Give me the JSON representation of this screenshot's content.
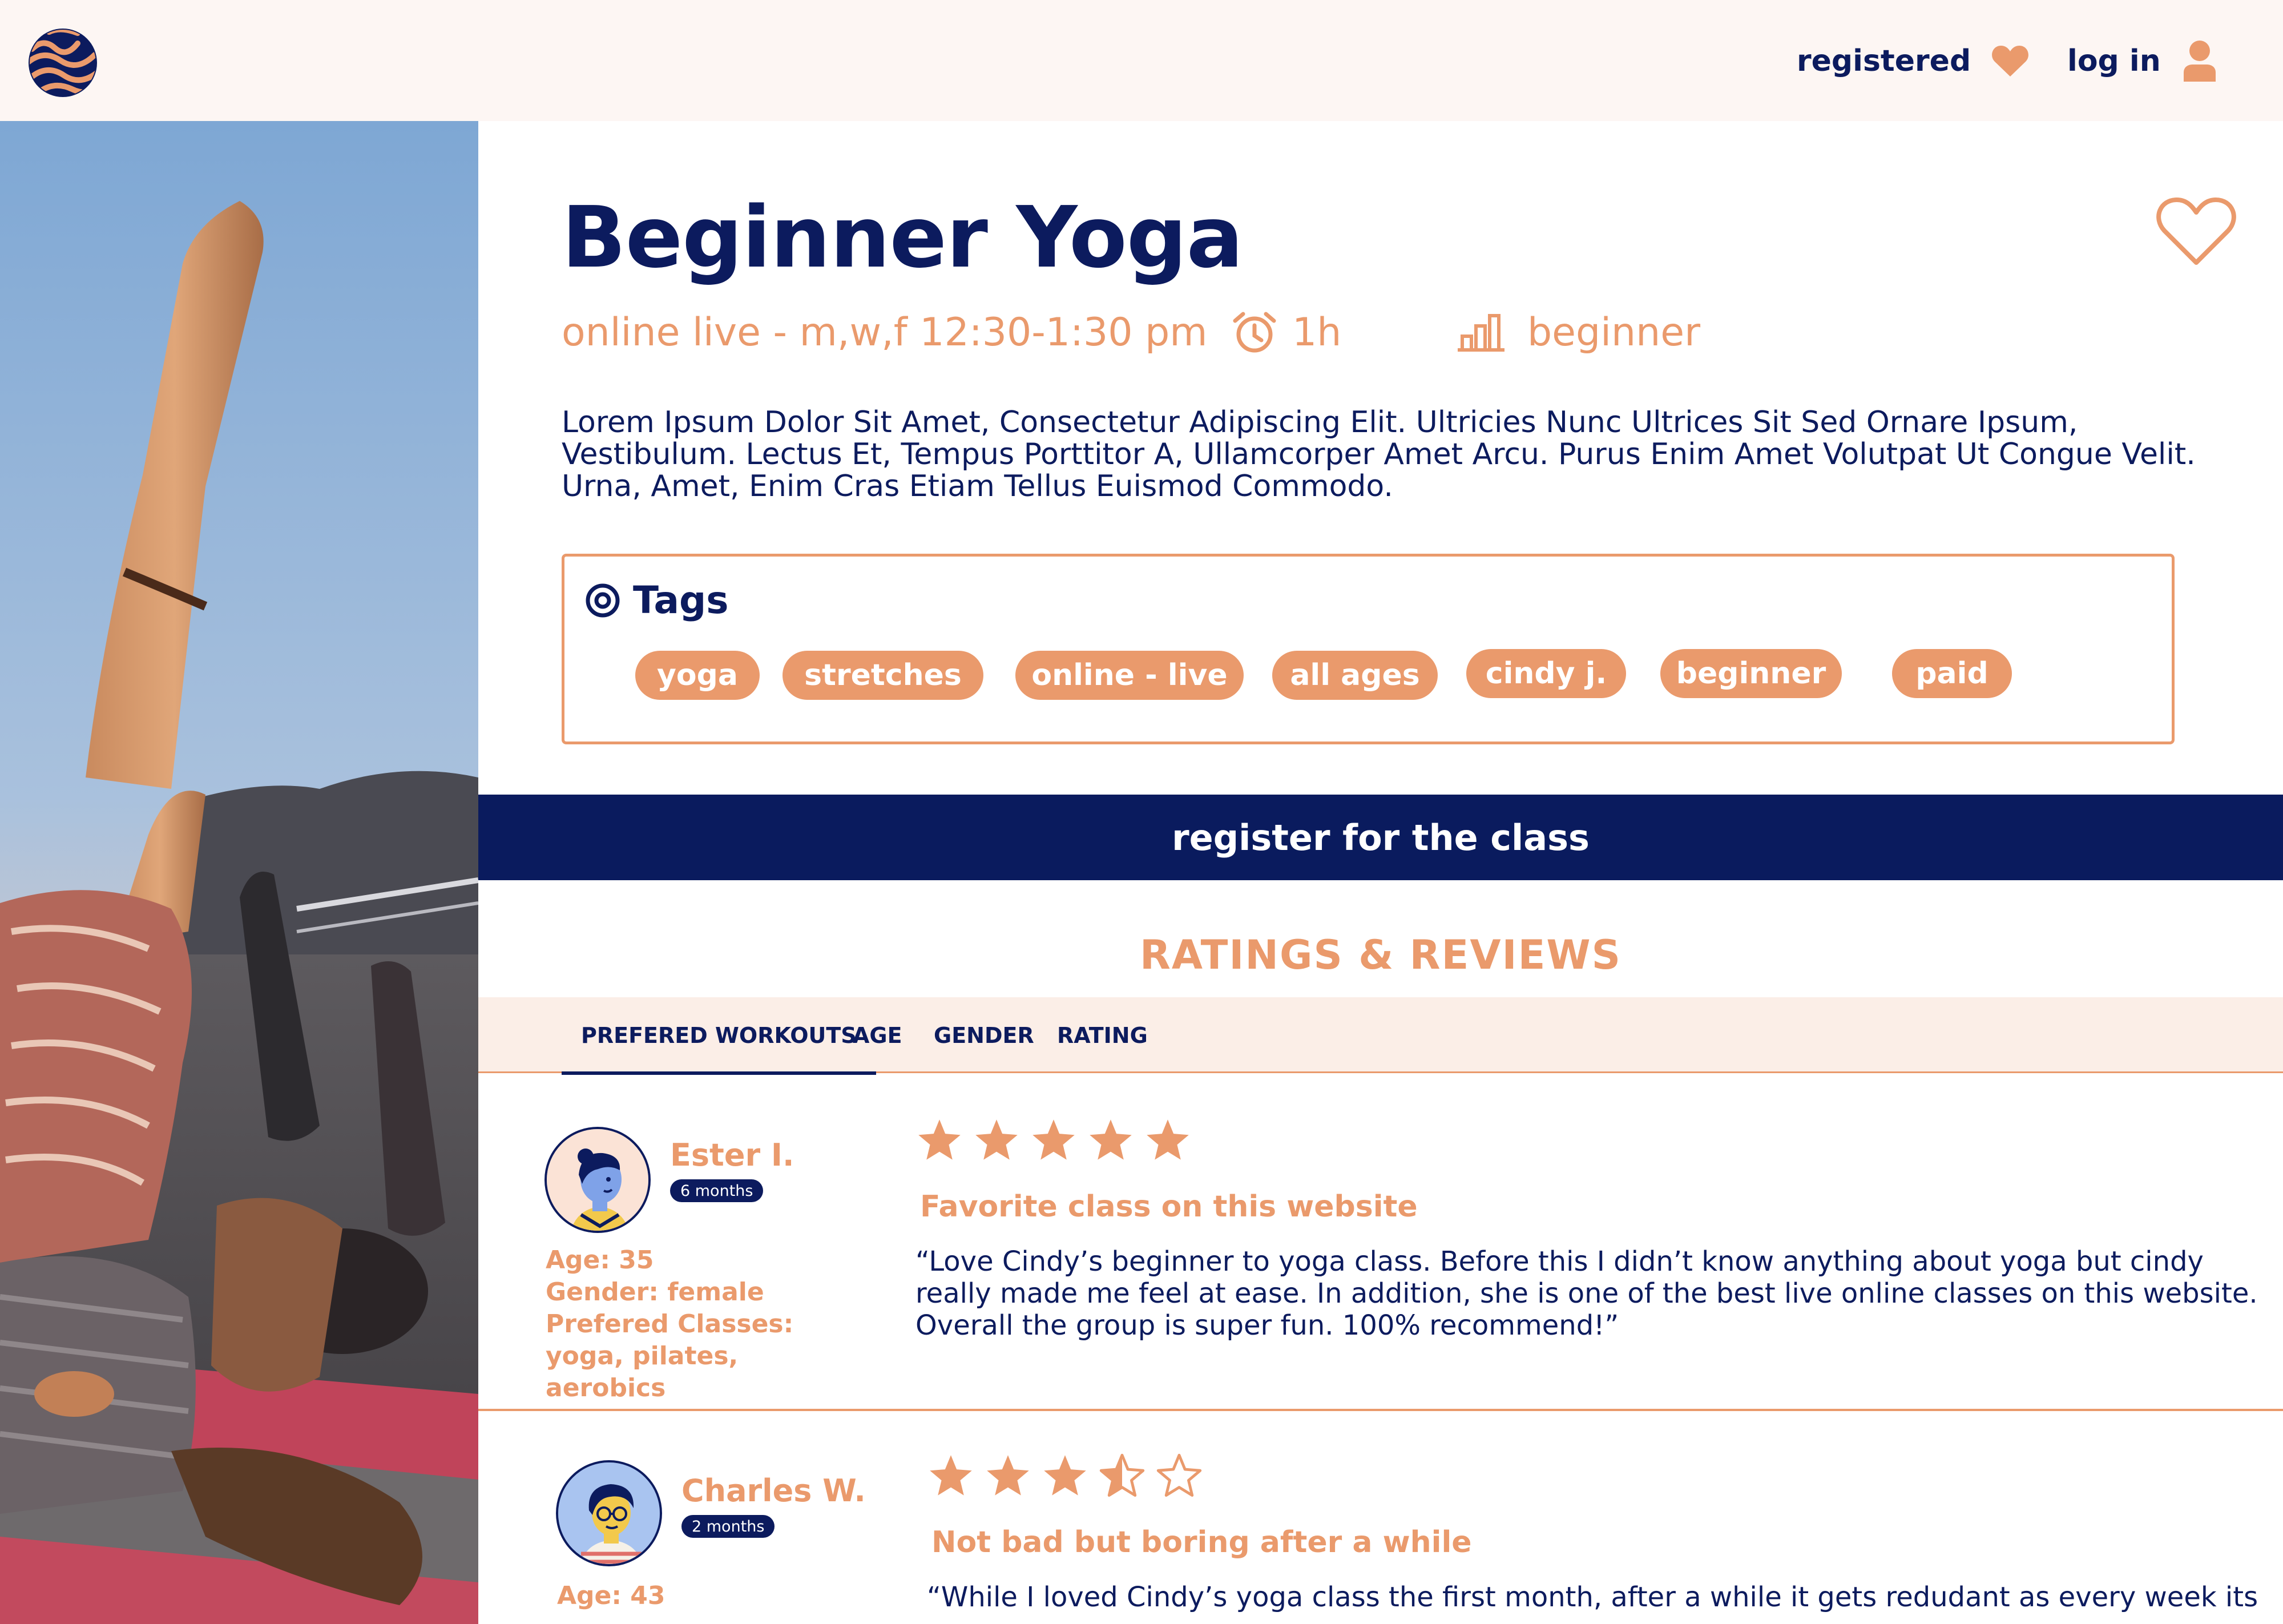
{
  "header": {
    "registered_label": "registered",
    "login_label": "log in",
    "brand_color": "#ea9a6c",
    "navy_color": "#0c1b5e"
  },
  "class_info": {
    "title": "Beginner Yoga",
    "schedule": "online live - m,w,f  12:30-1:30 pm",
    "duration": "1h",
    "level": "beginner",
    "description": "Lorem Ipsum Dolor Sit Amet, Consectetur Adipiscing Elit. Ultricies Nunc Ultrices Sit Sed Ornare Ipsum, Vestibulum. Lectus Et, Tempus Porttitor A, Ullamcorper Amet Arcu. Purus Enim Amet Volutpat Ut Congue Velit. Urna, Amet, Enim Cras Etiam Tellus Euismod Commodo."
  },
  "tags": {
    "title": "Tags",
    "items": [
      "yoga",
      "stretches",
      "online - live",
      "all ages",
      "cindy j.",
      "beginner",
      "paid"
    ]
  },
  "register_button": "register for the class",
  "reviews": {
    "title": "RATINGS  & REVIEWS",
    "filters": [
      "PREFERED WORKOUTS",
      "AGE",
      "GENDER",
      "RATING"
    ],
    "active_filter": "PREFERED WORKOUTS",
    "items": [
      {
        "name": "Ester I.",
        "tenure": "6 months",
        "age": "Age: 35",
        "gender": "Gender: female",
        "classes": "Prefered Classes: yoga, pilates, aerobics",
        "rating": 5,
        "headline": "Favorite class on this website",
        "text": "“Love Cindy’s beginner to yoga class. Before this I didn’t know anything about yoga but cindy really made me feel at ease. In addition, she is one of the best live online classes on this website. Overall the group is super fun. 100% recommend!”"
      },
      {
        "name": "Charles W.",
        "tenure": "2 months",
        "age": "Age: 43",
        "rating": 3.5,
        "headline": "Not bad but boring after a while",
        "text": "“While I loved Cindy’s yoga class the first month, after a while it gets redudant as every week its"
      }
    ]
  },
  "icons": {
    "logo": "striped-globe-logo",
    "registered": "heart-icon",
    "login": "user-icon",
    "favorite": "heart-outline-icon",
    "duration": "alarm-clock-icon",
    "level": "bar-chart-icon",
    "tags": "target-icon",
    "rating": "star-icon"
  }
}
